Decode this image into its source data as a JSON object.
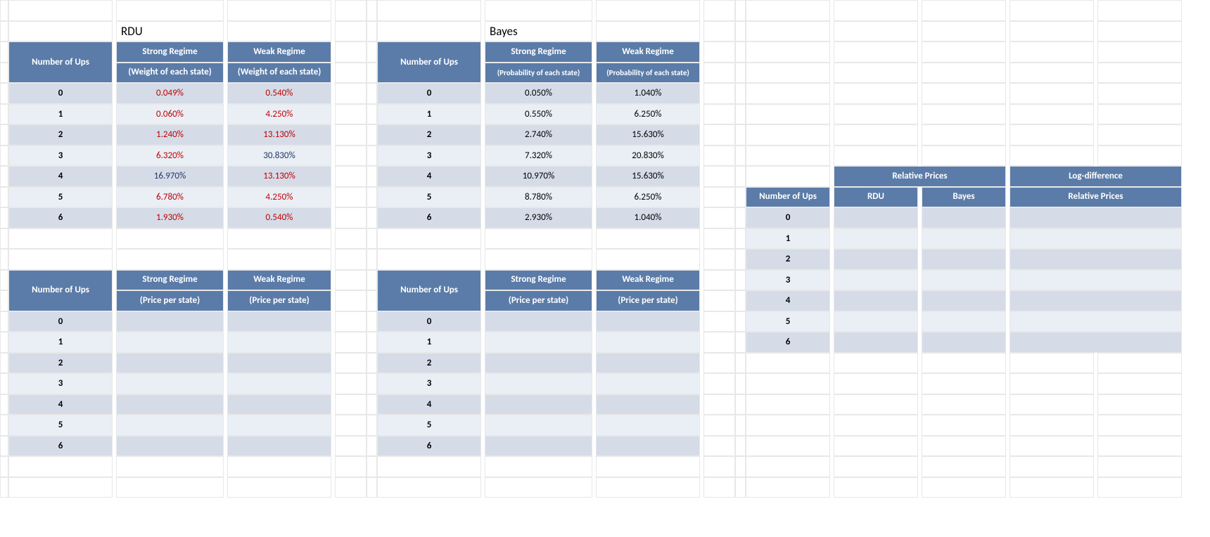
{
  "sections": {
    "rdu_title": "RDU",
    "bayes_title": "Bayes"
  },
  "headers": {
    "number_of_ups": "Number of Ups",
    "strong_regime": "Strong Regime",
    "weak_regime": "Weak Regime",
    "weight_of_each_state": "(Weight of each state)",
    "probability_of_each_state": "(Probability of each state)",
    "price_per_state": "(Price per state)",
    "relative_prices": "Relative Prices",
    "log_difference": "Log-difference",
    "rdu": "RDU",
    "bayes": "Bayes"
  },
  "rdu_weights": [
    {
      "n": "0",
      "strong": "0.049%",
      "weak": "0.540%",
      "s_cls": "val-red",
      "w_cls": "val-red"
    },
    {
      "n": "1",
      "strong": "0.060%",
      "weak": "4.250%",
      "s_cls": "val-red",
      "w_cls": "val-red"
    },
    {
      "n": "2",
      "strong": "1.240%",
      "weak": "13.130%",
      "s_cls": "val-red",
      "w_cls": "val-red"
    },
    {
      "n": "3",
      "strong": "6.320%",
      "weak": "30.830%",
      "s_cls": "val-red",
      "w_cls": "val-blue"
    },
    {
      "n": "4",
      "strong": "16.970%",
      "weak": "13.130%",
      "s_cls": "val-blue",
      "w_cls": "val-red"
    },
    {
      "n": "5",
      "strong": "6.780%",
      "weak": "4.250%",
      "s_cls": "val-red",
      "w_cls": "val-red"
    },
    {
      "n": "6",
      "strong": "1.930%",
      "weak": "0.540%",
      "s_cls": "val-red",
      "w_cls": "val-red"
    }
  ],
  "bayes_prob": [
    {
      "n": "0",
      "strong": "0.050%",
      "weak": "1.040%"
    },
    {
      "n": "1",
      "strong": "0.550%",
      "weak": "6.250%"
    },
    {
      "n": "2",
      "strong": "2.740%",
      "weak": "15.630%"
    },
    {
      "n": "3",
      "strong": "7.320%",
      "weak": "20.830%"
    },
    {
      "n": "4",
      "strong": "10.970%",
      "weak": "15.630%"
    },
    {
      "n": "5",
      "strong": "8.780%",
      "weak": "6.250%"
    },
    {
      "n": "6",
      "strong": "2.930%",
      "weak": "1.040%"
    }
  ],
  "price_rows": [
    "0",
    "1",
    "2",
    "3",
    "4",
    "5",
    "6"
  ],
  "relprice_rows": [
    "0",
    "1",
    "2",
    "3",
    "4",
    "5",
    "6"
  ]
}
